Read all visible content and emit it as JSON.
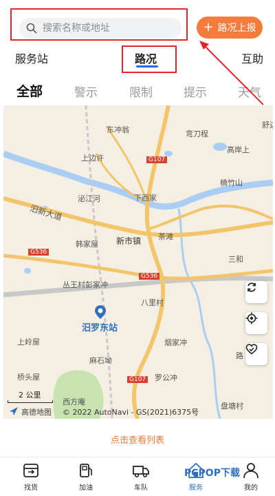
{
  "search": {
    "placeholder": "搜索名称或地址"
  },
  "header": {
    "report_label": "路况上报"
  },
  "category_tabs": [
    {
      "label": "服务站"
    },
    {
      "label": "路况"
    },
    {
      "label": "互助"
    }
  ],
  "filter_tabs": [
    {
      "label": "全部"
    },
    {
      "label": "警示"
    },
    {
      "label": "限制"
    },
    {
      "label": "提示"
    },
    {
      "label": "天气"
    }
  ],
  "map": {
    "labels": {
      "dongchongweng": "东冲翁",
      "wandaocheng": "弯刀程",
      "shubian": "舒边",
      "gaoxianshang": "高岸上",
      "shangbianxu": "上边许",
      "g107_top": "G107",
      "nanzhushan": "楠竹山",
      "xiajiangli": "泌江河",
      "xiaxijia": "下西家",
      "miluo_road": "汨新大道",
      "hanjiawu": "韩家屋",
      "xinshizhen": "新市镇",
      "chatan": "茶滩",
      "sanhe": "三和",
      "g536_left": "G536",
      "g536_mid": "G536",
      "congwangcun": "丛王村彭家冲",
      "balicun": "八里村",
      "yandianchong": "烟家冲",
      "miluodongzhan": "汨罗东站",
      "shangewu": "上岭屋",
      "mashidi": "麻石坳",
      "qiaotouwu": "桥头屋",
      "luogongchong": "罗公冲",
      "g107_bottom": "G107",
      "xifangyi": "西方庵",
      "pantangcun": "盘塘村",
      "lu": "路",
      "scale": "2 公里",
      "copyright": "© 2022 AutoNavi - GS(2021)6375号",
      "brand": "高德地图"
    },
    "colors": {
      "land": "#f4efe2",
      "road": "#f2c56b",
      "water": "#a9cdf3",
      "rail": "#c9c9c9"
    }
  },
  "list_link": "点击查看列表",
  "nav": [
    {
      "label": "找货",
      "icon": "cargo-icon"
    },
    {
      "label": "加油",
      "icon": "fuel-icon"
    },
    {
      "label": "车队",
      "icon": "truck-icon"
    },
    {
      "label": "服务",
      "icon": "service-icon"
    },
    {
      "label": "我的",
      "icon": "person-icon"
    }
  ],
  "watermark": "PCPOP下载"
}
